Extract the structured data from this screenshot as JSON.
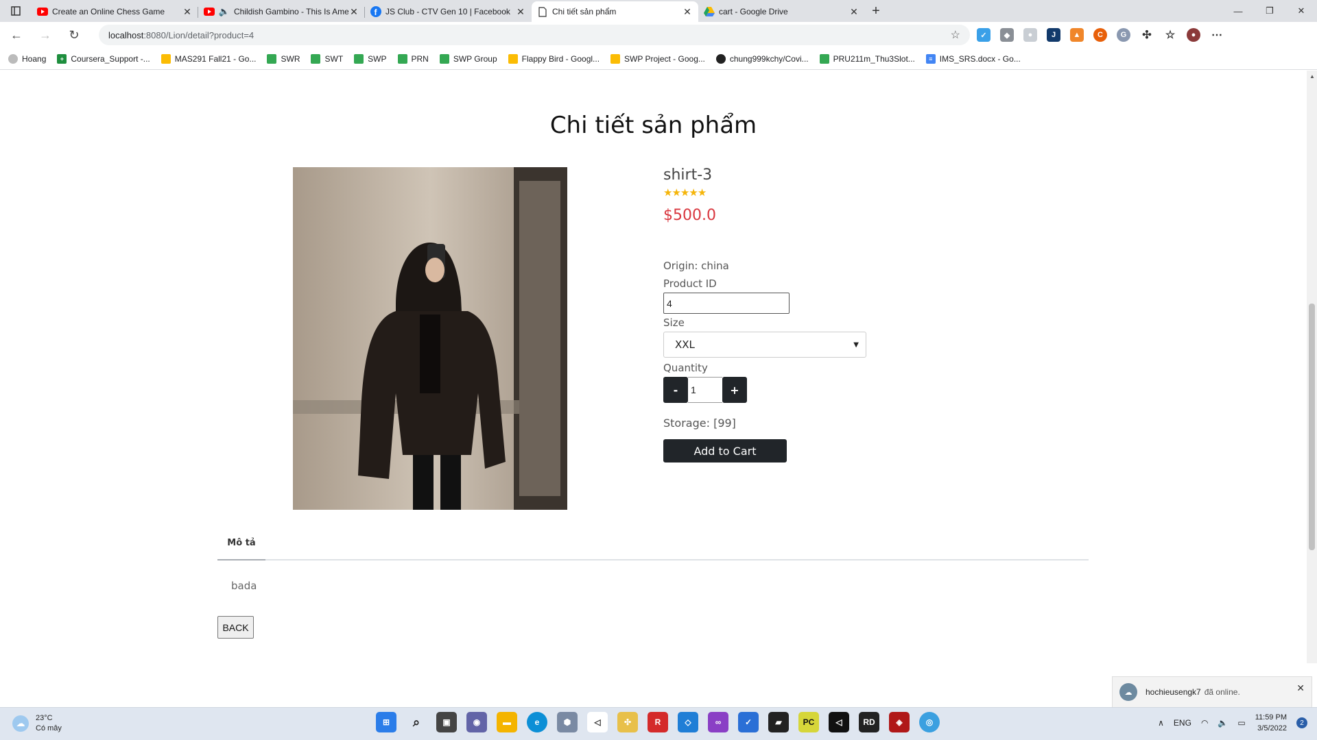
{
  "browser": {
    "tabs": [
      {
        "title": "Create an Online Chess Game",
        "favicon": "youtube-icon"
      },
      {
        "title": "Childish Gambino - This Is America",
        "favicon": "youtube-icon"
      },
      {
        "title": "JS Club - CTV Gen 10 | Facebook",
        "favicon": "facebook-icon"
      },
      {
        "title": "Chi tiết sản phẩm",
        "favicon": "page-icon"
      },
      {
        "title": "cart - Google Drive",
        "favicon": "drive-icon"
      }
    ],
    "url_host": "localhost",
    "url_rest": ":8080/Lion/detail?product=4",
    "bookmarks": [
      "Hoang",
      "Coursera_Support -...",
      "MAS291 Fall21 - Go...",
      "SWR",
      "SWT",
      "SWP",
      "PRN",
      "SWP Group",
      "Flappy Bird - Googl...",
      "SWP Project - Goog...",
      "chung999kchy/Covi...",
      "PRU211m_Thu3Slot...",
      "IMS_SRS.docx - Go..."
    ]
  },
  "page": {
    "title": "Chi tiết sản phẩm",
    "product": {
      "name": "shirt-3",
      "rating_stars": 5,
      "price": "$500.0",
      "origin": "Origin: china",
      "product_id_label": "Product ID",
      "product_id_value": "4",
      "size_label": "Size",
      "size_value": "XXL",
      "quantity_label": "Quantity",
      "quantity_value": "1",
      "minus": "-",
      "plus": "+",
      "storage": "Storage: [99]",
      "add_to_cart": "Add to Cart"
    },
    "tab_description": "Mô tả",
    "description": "bada",
    "back": "BACK"
  },
  "notification": {
    "user": "hochieusengk7",
    "text": "đã online."
  },
  "taskbar": {
    "temperature": "23°C",
    "weather": "Có mây",
    "lang": "ENG",
    "time": "11:59 PM",
    "date": "3/5/2022",
    "badge": "2"
  }
}
